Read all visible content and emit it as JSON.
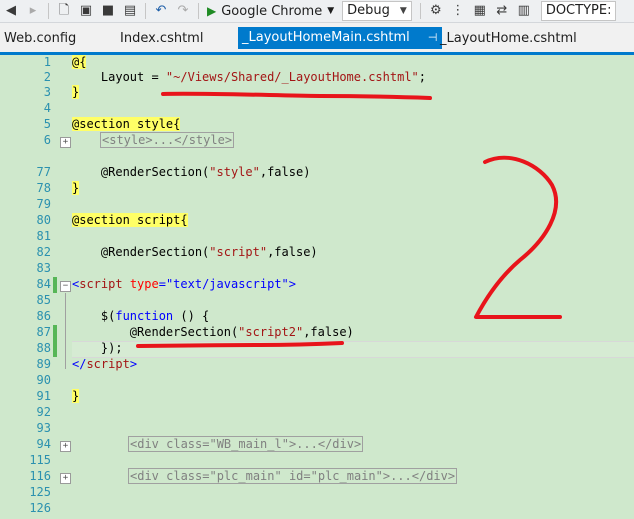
{
  "toolbar": {
    "run_target": "Google Chrome",
    "config": "Debug",
    "doctype_label": "DOCTYPE:",
    "icons": [
      "back-icon",
      "forward-icon",
      "new-project-icon",
      "open-icon",
      "save-icon",
      "save-all-icon",
      "undo-icon",
      "redo-icon",
      "run-icon",
      "attach-icon",
      "bookmark-icon",
      "comment-icon",
      "uncomment-icon"
    ]
  },
  "tabs": [
    {
      "label": "Web.config"
    },
    {
      "label": "Index.cshtml"
    },
    {
      "label": "_LayoutHomeMain.cshtml",
      "active": true,
      "pin": "⊣",
      "close": "×"
    },
    {
      "label": "_LayoutHome.cshtml"
    }
  ],
  "lines": [
    {
      "num": "1"
    },
    {
      "num": "2"
    },
    {
      "num": "3"
    },
    {
      "num": "4"
    },
    {
      "num": "5"
    },
    {
      "num": "6"
    },
    {
      "num": "77"
    },
    {
      "num": "78"
    },
    {
      "num": "79"
    },
    {
      "num": "80"
    },
    {
      "num": "81"
    },
    {
      "num": "82"
    },
    {
      "num": "83"
    },
    {
      "num": "84"
    },
    {
      "num": "85"
    },
    {
      "num": "86"
    },
    {
      "num": "87"
    },
    {
      "num": "88"
    },
    {
      "num": "89"
    },
    {
      "num": "90"
    },
    {
      "num": "91"
    },
    {
      "num": "92"
    },
    {
      "num": "93"
    },
    {
      "num": "94"
    },
    {
      "num": "115"
    },
    {
      "num": "116"
    },
    {
      "num": "125"
    },
    {
      "num": "126"
    }
  ],
  "code": {
    "l1": "@{",
    "l2a": "    Layout = ",
    "l2b": "\"~/Views/Shared/_LayoutHome.cshtml\"",
    "l2c": ";",
    "l3": "}",
    "l5a": "@section ",
    "l5b": "style",
    "l5c": "{",
    "l6": "<style>...</style>",
    "l77a": "    @RenderSection(",
    "l77b": "\"style\"",
    "l77c": ",false)",
    "l78": "}",
    "l80a": "@section ",
    "l80b": "script",
    "l80c": "{",
    "l82a": "    @RenderSection(",
    "l82b": "\"script\"",
    "l82c": ",false)",
    "l84a": "<",
    "l84b": "script",
    "l84c": " type",
    "l84d": "=",
    "l84e": "\"text/javascript\"",
    "l84f": ">",
    "l86a": "    $(",
    "l86b": "function",
    "l86c": " () {",
    "l87a": "        @RenderSection(",
    "l87b": "\"script2\"",
    "l87c": ",false)",
    "l88": "    });",
    "l89a": "</",
    "l89b": "script",
    "l89c": ">",
    "l91": "}",
    "l94": "<div class=\"WB_main_l\">...</div>",
    "l116": "<div class=\"plc_main\" id=\"plc_main\">...</div>"
  },
  "annotation": {
    "scribble_color": "#e8141b",
    "handwritten_number": "2"
  }
}
